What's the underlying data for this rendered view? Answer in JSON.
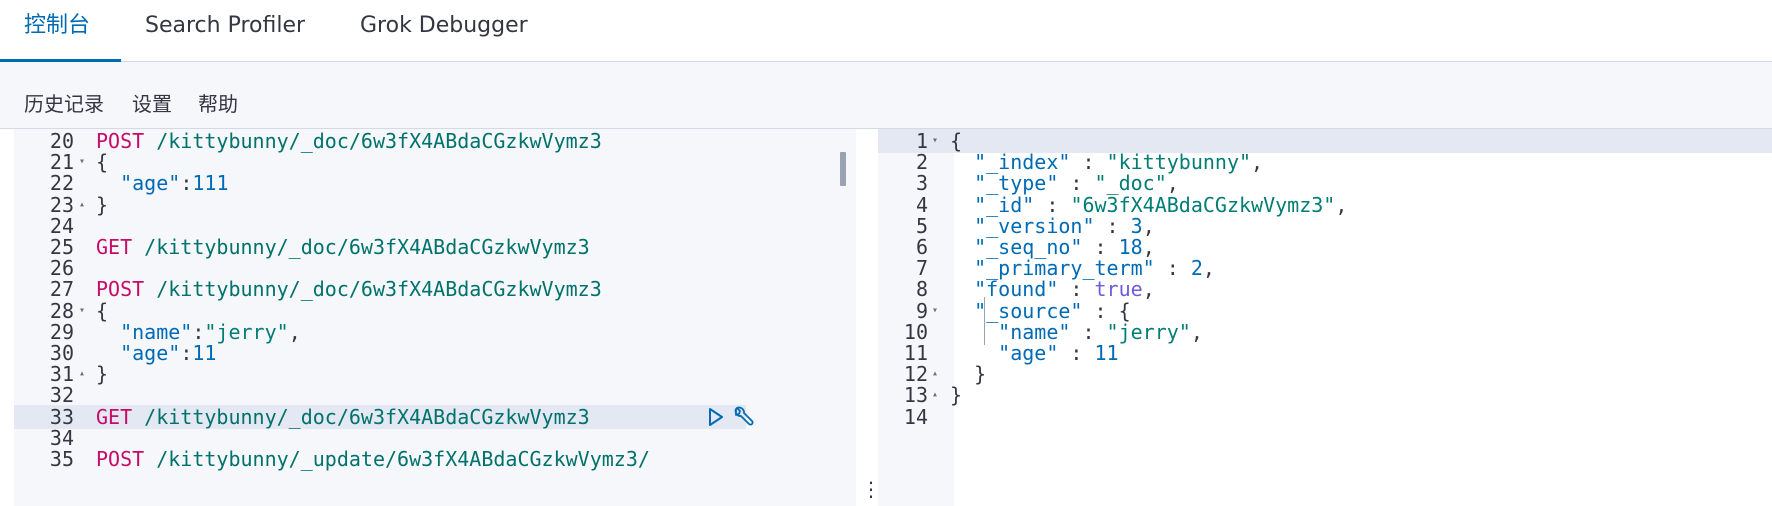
{
  "tabs": [
    {
      "label": "控制台",
      "active": true
    },
    {
      "label": "Search Profiler",
      "active": false
    },
    {
      "label": "Grok Debugger",
      "active": false
    }
  ],
  "toolbar": {
    "history": "历史记录",
    "settings": "设置",
    "help": "帮助"
  },
  "editor": {
    "lines": [
      {
        "n": "20",
        "fold": "",
        "parts": [
          [
            "m",
            "POST"
          ],
          [
            "p",
            " "
          ],
          [
            "u",
            "/kittybunny/_doc/6w3fX4ABdaCGzkwVymz3"
          ]
        ]
      },
      {
        "n": "21",
        "fold": "down",
        "parts": [
          [
            "p",
            "{"
          ]
        ]
      },
      {
        "n": "22",
        "fold": "",
        "parts": [
          [
            "p",
            "  "
          ],
          [
            "k",
            "\"age\""
          ],
          [
            "p",
            ":"
          ],
          [
            "n",
            "111"
          ]
        ]
      },
      {
        "n": "23",
        "fold": "up",
        "parts": [
          [
            "p",
            "}"
          ]
        ]
      },
      {
        "n": "24",
        "fold": "",
        "parts": []
      },
      {
        "n": "25",
        "fold": "",
        "parts": [
          [
            "m",
            "GET"
          ],
          [
            "p",
            " "
          ],
          [
            "u",
            "/kittybunny/_doc/6w3fX4ABdaCGzkwVymz3"
          ]
        ]
      },
      {
        "n": "26",
        "fold": "",
        "parts": []
      },
      {
        "n": "27",
        "fold": "",
        "parts": [
          [
            "m",
            "POST"
          ],
          [
            "p",
            " "
          ],
          [
            "u",
            "/kittybunny/_doc/6w3fX4ABdaCGzkwVymz3"
          ]
        ]
      },
      {
        "n": "28",
        "fold": "down",
        "parts": [
          [
            "p",
            "{"
          ]
        ]
      },
      {
        "n": "29",
        "fold": "",
        "parts": [
          [
            "p",
            "  "
          ],
          [
            "k",
            "\"name\""
          ],
          [
            "p",
            ":"
          ],
          [
            "s",
            "\"jerry\""
          ],
          [
            "p",
            ","
          ]
        ]
      },
      {
        "n": "30",
        "fold": "",
        "parts": [
          [
            "p",
            "  "
          ],
          [
            "k",
            "\"age\""
          ],
          [
            "p",
            ":"
          ],
          [
            "n",
            "11"
          ]
        ]
      },
      {
        "n": "31",
        "fold": "up",
        "parts": [
          [
            "p",
            "}"
          ]
        ]
      },
      {
        "n": "32",
        "fold": "",
        "parts": []
      },
      {
        "n": "33",
        "fold": "",
        "highlight": true,
        "parts": [
          [
            "m",
            "GET"
          ],
          [
            "p",
            " "
          ],
          [
            "u",
            "/kittybunny/_doc/6w3fX4ABdaCGzkwVymz3"
          ]
        ]
      },
      {
        "n": "34",
        "fold": "",
        "parts": []
      },
      {
        "n": "35",
        "fold": "",
        "parts": [
          [
            "m",
            "POST"
          ],
          [
            "p",
            " "
          ],
          [
            "u",
            "/kittybunny/_update/6w3fX4ABdaCGzkwVymz3/"
          ]
        ]
      }
    ],
    "run_icon": "play-icon",
    "options_icon": "wrench-icon"
  },
  "divider": {
    "dots": "⋮"
  },
  "output": {
    "lines": [
      {
        "n": "1",
        "fold": "down",
        "highlight": true,
        "parts": [
          [
            "p",
            "{"
          ]
        ]
      },
      {
        "n": "2",
        "fold": "",
        "parts": [
          [
            "p",
            "  "
          ],
          [
            "k",
            "\"_index\""
          ],
          [
            "p",
            " : "
          ],
          [
            "s",
            "\"kittybunny\""
          ],
          [
            "p",
            ","
          ]
        ]
      },
      {
        "n": "3",
        "fold": "",
        "parts": [
          [
            "p",
            "  "
          ],
          [
            "k",
            "\"_type\""
          ],
          [
            "p",
            " : "
          ],
          [
            "s",
            "\"_doc\""
          ],
          [
            "p",
            ","
          ]
        ]
      },
      {
        "n": "4",
        "fold": "",
        "parts": [
          [
            "p",
            "  "
          ],
          [
            "k",
            "\"_id\""
          ],
          [
            "p",
            " : "
          ],
          [
            "s",
            "\"6w3fX4ABdaCGzkwVymz3\""
          ],
          [
            "p",
            ","
          ]
        ]
      },
      {
        "n": "5",
        "fold": "",
        "parts": [
          [
            "p",
            "  "
          ],
          [
            "k",
            "\"_version\""
          ],
          [
            "p",
            " : "
          ],
          [
            "n",
            "3"
          ],
          [
            "p",
            ","
          ]
        ]
      },
      {
        "n": "6",
        "fold": "",
        "parts": [
          [
            "p",
            "  "
          ],
          [
            "k",
            "\"_seq_no\""
          ],
          [
            "p",
            " : "
          ],
          [
            "n",
            "18"
          ],
          [
            "p",
            ","
          ]
        ]
      },
      {
        "n": "7",
        "fold": "",
        "parts": [
          [
            "p",
            "  "
          ],
          [
            "k",
            "\"_primary_term\""
          ],
          [
            "p",
            " : "
          ],
          [
            "n",
            "2"
          ],
          [
            "p",
            ","
          ]
        ]
      },
      {
        "n": "8",
        "fold": "",
        "parts": [
          [
            "p",
            "  "
          ],
          [
            "k",
            "\"found\""
          ],
          [
            "p",
            " : "
          ],
          [
            "kw",
            "true"
          ],
          [
            "p",
            ","
          ]
        ]
      },
      {
        "n": "9",
        "fold": "down",
        "parts": [
          [
            "p",
            "  "
          ],
          [
            "k",
            "\"_source\""
          ],
          [
            "p",
            " : {"
          ]
        ]
      },
      {
        "n": "10",
        "fold": "",
        "parts": [
          [
            "p",
            "    "
          ],
          [
            "k",
            "\"name\""
          ],
          [
            "p",
            " : "
          ],
          [
            "s",
            "\"jerry\""
          ],
          [
            "p",
            ","
          ]
        ]
      },
      {
        "n": "11",
        "fold": "",
        "parts": [
          [
            "p",
            "    "
          ],
          [
            "k",
            "\"age\""
          ],
          [
            "p",
            " : "
          ],
          [
            "n",
            "11"
          ]
        ]
      },
      {
        "n": "12",
        "fold": "up",
        "parts": [
          [
            "p",
            "  }"
          ]
        ]
      },
      {
        "n": "13",
        "fold": "up",
        "parts": [
          [
            "p",
            "}"
          ]
        ]
      },
      {
        "n": "14",
        "fold": "",
        "parts": []
      }
    ]
  },
  "colors": {
    "accent": "#006bb4",
    "method": "#c80a68",
    "url": "#00726b",
    "string": "#017d73",
    "number": "#006bb4",
    "boolean": "#6c5dd6"
  }
}
